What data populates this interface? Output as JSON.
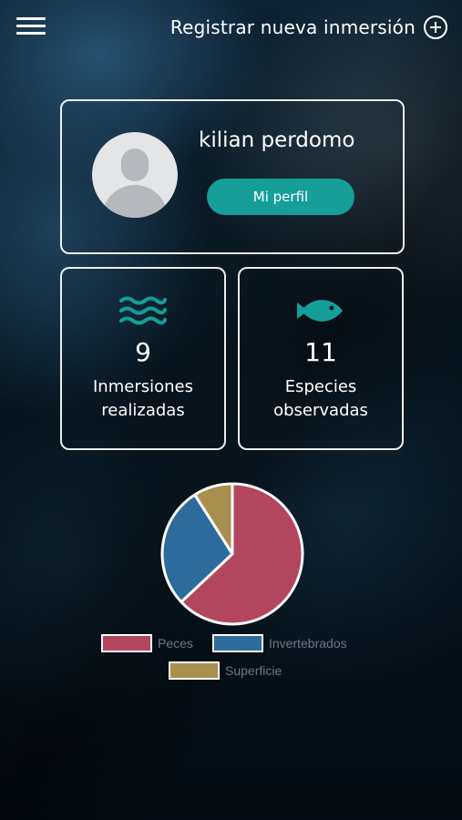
{
  "header": {
    "menu_icon": "hamburger-menu-icon",
    "register_label": "Registrar nueva inmersión",
    "register_icon": "plus-circle-icon"
  },
  "profile": {
    "name": "kilian perdomo",
    "button_label": "Mi perfil",
    "avatar_icon": "default-user-avatar",
    "button_color": "#159e9a"
  },
  "stats": [
    {
      "icon": "waves-icon",
      "count": "9",
      "label_line1": "Inmersiones",
      "label_line2": "realizadas"
    },
    {
      "icon": "fish-icon",
      "count": "11",
      "label_line1": "Especies",
      "label_line2": "observadas"
    }
  ],
  "accent_color": "#159e9a",
  "chart_data": {
    "type": "pie",
    "categories": [
      "Peces",
      "Invertebrados",
      "Superficie"
    ],
    "values": [
      63,
      28,
      9
    ],
    "colors": [
      "#b2465f",
      "#2d6b9c",
      "#a88f4e"
    ],
    "legend_position": "bottom"
  }
}
